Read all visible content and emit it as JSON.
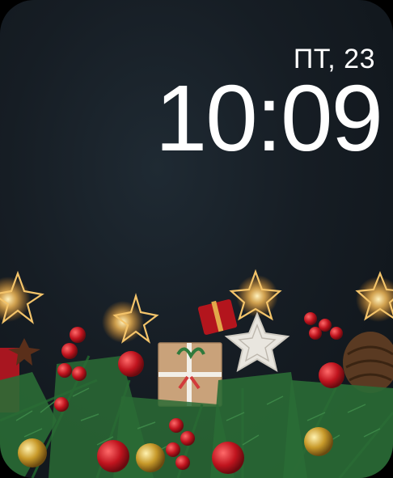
{
  "watch_face": {
    "date_label": "ПТ, 23",
    "time": "10:09",
    "background": "christmas-garland-photo"
  },
  "colors": {
    "background": "#161d24",
    "text": "#ffffff",
    "fir": "#1f5a2c",
    "berry": "#c0141e",
    "light": "#ffd27a"
  }
}
